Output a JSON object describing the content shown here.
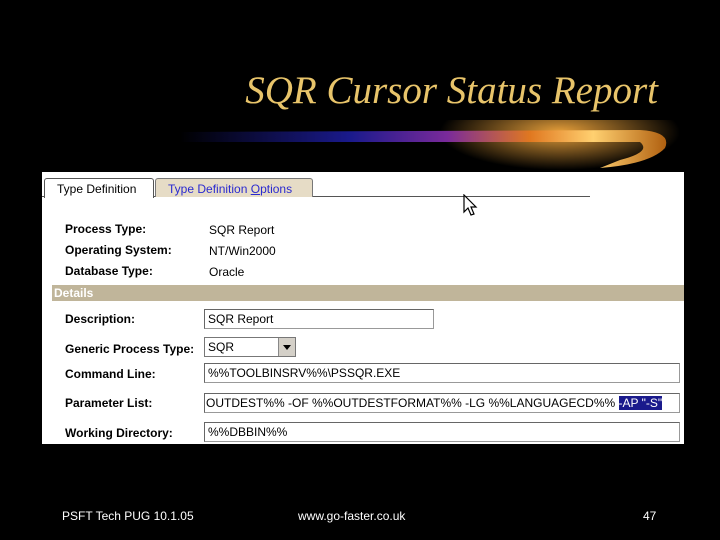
{
  "slide": {
    "title": "SQR Cursor Status Report",
    "footer_left": "PSFT Tech PUG 10.1.05",
    "footer_center": "www.go-faster.co.uk",
    "page_number": "47"
  },
  "tabs": [
    {
      "label": "Type Definition",
      "active": true
    },
    {
      "label_pre": "Type Definition ",
      "label_underlined": "O",
      "label_post": "ptions",
      "active": false
    }
  ],
  "fields": {
    "process_type": {
      "label": "Process Type:",
      "value": "SQR Report"
    },
    "operating_system": {
      "label": "Operating System:",
      "value": "NT/Win2000"
    },
    "database_type": {
      "label": "Database Type:",
      "value": "Oracle"
    }
  },
  "details": {
    "section_label": "Details",
    "description": {
      "label": "Description:",
      "value": "SQR Report"
    },
    "generic_process_type": {
      "label": "Generic Process Type:",
      "value": "SQR"
    },
    "command_line": {
      "label": "Command Line:",
      "value": "%%TOOLBINSRV%%\\PSSQR.EXE"
    },
    "parameter_list": {
      "label": "Parameter List:",
      "value_plain": "OUTDEST%% -OF %%OUTDESTFORMAT%% -LG %%LANGUAGECD%% ",
      "value_selected": "-AP \"-S\""
    },
    "working_directory": {
      "label": "Working Directory:",
      "value": "%%DBBIN%%"
    }
  },
  "colors": {
    "background": "#000000",
    "title": "#e8c46a",
    "section_bar": "#c0b59a",
    "selection": "#1a1a8c",
    "inactive_tab": "#e6dcc6"
  }
}
